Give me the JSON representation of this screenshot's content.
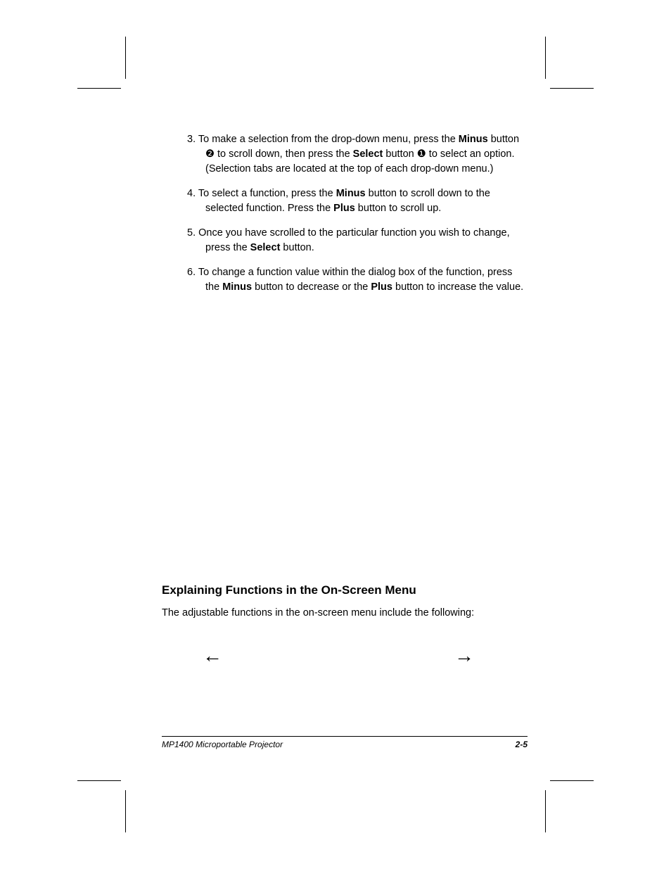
{
  "steps": {
    "s3_a": "3. To make a selection from the drop-down menu, press the ",
    "s3_b": " button ",
    "s3_c": " to scroll down, then press the ",
    "s3_d": " button ",
    "s3_e": " to select an option. (Selection tabs are located at the top of each drop-down menu.)",
    "s4_a": "4. To select a function, press the ",
    "s4_b": " button to scroll down to the selected function. Press the ",
    "s4_c": " button to scroll up.",
    "s5_a": "5. Once you have scrolled to the particular function you wish to change, press the ",
    "s5_b": " button.",
    "s6_a": "6. To change a function value within the dialog box of the function, press the ",
    "s6_b": " button to decrease or the ",
    "s6_c": " button to increase the value.",
    "bold": {
      "minus": "Minus",
      "plus": "Plus",
      "select": "Select"
    },
    "circ": {
      "one": "❶",
      "two": "❷"
    }
  },
  "heading": "Explaining Functions in the On-Screen Menu",
  "after_heading": "The adjustable functions in the on-screen menu include the following:",
  "symbols": {
    "left": "←",
    "right": "→"
  },
  "footer": {
    "left": "MP1400 Microportable Projector",
    "right": "2-5"
  }
}
